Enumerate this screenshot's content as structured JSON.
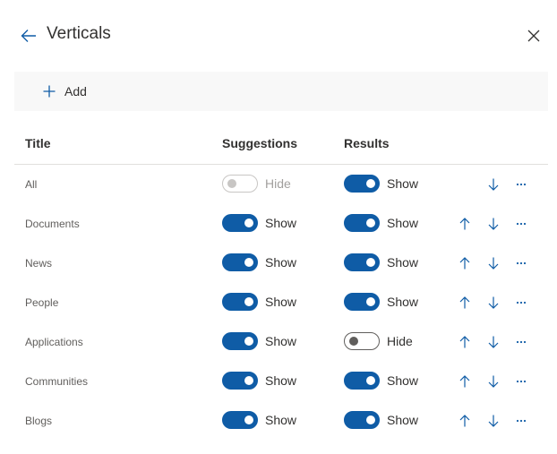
{
  "header": {
    "title": "Verticals",
    "back_icon": "arrow-left-icon",
    "close_icon": "close-icon"
  },
  "toolbar": {
    "add_label": "Add",
    "add_icon": "plus-icon"
  },
  "columns": {
    "title": "Title",
    "suggestions": "Suggestions",
    "results": "Results"
  },
  "colors": {
    "accent": "#0f5ca6",
    "text": "#323130",
    "muted": "#605e5c",
    "disabled": "#a19f9d",
    "command_bar": "#f8f8f8"
  },
  "rows": [
    {
      "title": "All",
      "suggestions": {
        "on": false,
        "label": "Hide",
        "disabled": true
      },
      "results": {
        "on": true,
        "label": "Show"
      },
      "move_up": false,
      "move_down": true
    },
    {
      "title": "Documents",
      "suggestions": {
        "on": true,
        "label": "Show"
      },
      "results": {
        "on": true,
        "label": "Show"
      },
      "move_up": true,
      "move_down": true
    },
    {
      "title": "News",
      "suggestions": {
        "on": true,
        "label": "Show"
      },
      "results": {
        "on": true,
        "label": "Show"
      },
      "move_up": true,
      "move_down": true
    },
    {
      "title": "People",
      "suggestions": {
        "on": true,
        "label": "Show"
      },
      "results": {
        "on": true,
        "label": "Show"
      },
      "move_up": true,
      "move_down": true
    },
    {
      "title": "Applications",
      "suggestions": {
        "on": true,
        "label": "Show"
      },
      "results": {
        "on": false,
        "label": "Hide"
      },
      "move_up": true,
      "move_down": true
    },
    {
      "title": "Communities",
      "suggestions": {
        "on": true,
        "label": "Show"
      },
      "results": {
        "on": true,
        "label": "Show"
      },
      "move_up": true,
      "move_down": true
    },
    {
      "title": "Blogs",
      "suggestions": {
        "on": true,
        "label": "Show"
      },
      "results": {
        "on": true,
        "label": "Show"
      },
      "move_up": true,
      "move_down": true
    }
  ]
}
